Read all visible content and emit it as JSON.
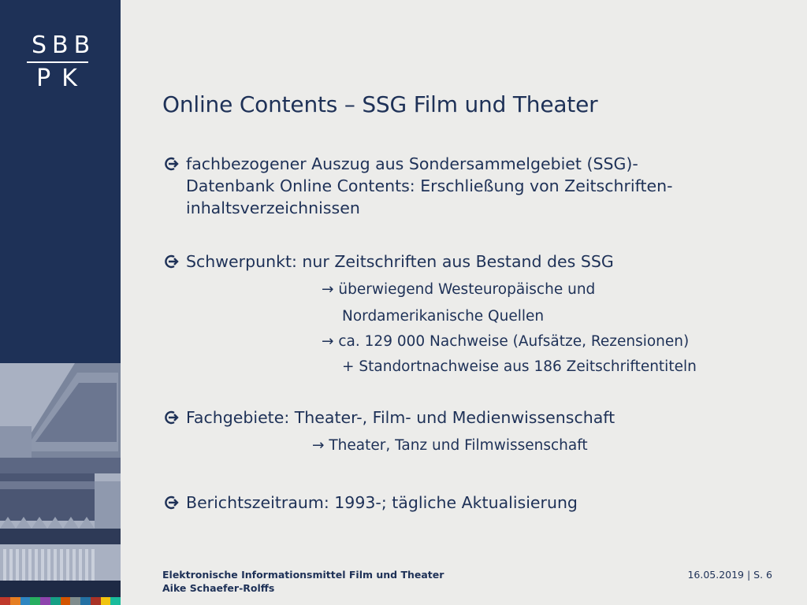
{
  "logo": {
    "top": "SBB",
    "bottom": "PK"
  },
  "title": "Online Contents – SSG Film und Theater",
  "bullets": [
    {
      "icon": "circle-arrow-icon",
      "lines": [
        "fachbezogener Auszug aus Sondersammelgebiet (SSG)-",
        "Datenbank Online Contents: Erschließung von Zeitschriften-",
        "inhaltsverzeichnissen"
      ]
    },
    {
      "icon": "circle-arrow-icon",
      "lines": [
        "Schwerpunkt: nur Zeitschriften aus Bestand des SSG"
      ]
    },
    {
      "icon": "circle-arrow-icon",
      "lines": [
        "Fachgebiete: Theater-, Film- und Medienwissenschaft"
      ]
    },
    {
      "icon": "circle-arrow-icon",
      "lines": [
        "Berichtszeitraum: 1993-; tägliche Aktualisierung"
      ]
    }
  ],
  "sub_items": {
    "s1": "→ überwiegend Westeuropäische und",
    "s2": "Nordamerikanische Quellen",
    "s3": "→ ca. 129 000 Nachweise (Aufsätze, Rezensionen)",
    "s4": "+ Standortnachweise aus 186 Zeitschriftentiteln",
    "s5": "→ Theater, Tanz und Filmwissenschaft"
  },
  "footer": {
    "line1": "Elektronische Informationsmittel Film und Theater",
    "line2": "Aike Schaefer-Rolffs",
    "date_page": "16.05.2019 | S. 6"
  },
  "colors": {
    "navy": "#1e3157",
    "background": "#ececea",
    "strip": [
      "#c0392b",
      "#e67e22",
      "#2e86c1",
      "#27ae60",
      "#8e44ad",
      "#16a085",
      "#d35400",
      "#7f8c8d",
      "#2471a3",
      "#a93226",
      "#f1c40f",
      "#1abc9c"
    ]
  }
}
